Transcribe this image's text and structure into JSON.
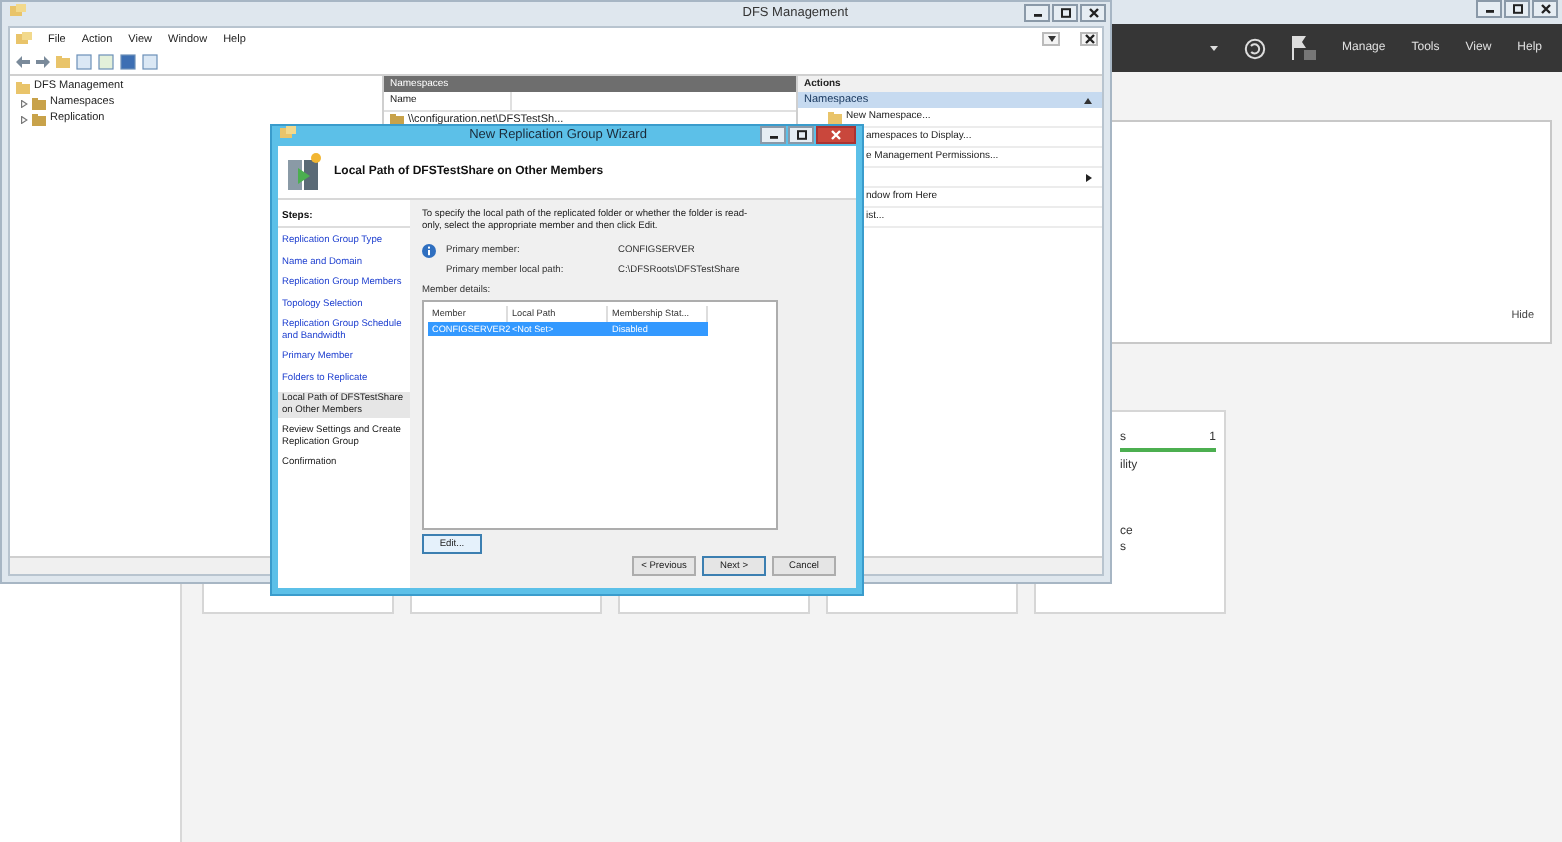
{
  "server_manager": {
    "menu": [
      "Manage",
      "Tools",
      "View",
      "Help"
    ],
    "welcome": {
      "hide_link": "Hide"
    },
    "tiles": [
      {
        "kind": "empty"
      },
      {
        "kind": "empty"
      },
      {
        "kind": "empty"
      },
      {
        "kind": "empty"
      },
      {
        "kind": "partial",
        "title": "s",
        "count": "1",
        "lines": [
          "ility",
          "ce",
          "s"
        ]
      }
    ]
  },
  "dfs_window": {
    "title": "DFS Management",
    "menu": [
      "File",
      "Action",
      "View",
      "Window",
      "Help"
    ],
    "tree": [
      {
        "label": "DFS Management",
        "children": [
          {
            "label": "Namespaces",
            "expanded": false
          },
          {
            "label": "Replication",
            "expanded": false
          }
        ]
      }
    ],
    "center_pane": {
      "header": "Namespaces",
      "columns": [
        "Name"
      ],
      "rows": [
        "\\\\configuration.net\\DFSTestSh..."
      ]
    },
    "actions_pane": {
      "title": "Actions",
      "section": "Namespaces",
      "expanded": true,
      "items": [
        {
          "kind": "command",
          "label": "New Namespace..."
        },
        {
          "kind": "clipped",
          "label": "amespaces to Display..."
        },
        {
          "kind": "clipped",
          "label": "e Management Permissions..."
        },
        {
          "kind": "submenu"
        },
        {
          "kind": "clipped",
          "label": "ndow from Here"
        },
        {
          "kind": "clipped",
          "label": "ist..."
        }
      ]
    }
  },
  "wizard": {
    "title": "New Replication Group Wizard",
    "heading": "Local Path of DFSTestShare on Other Members",
    "steps_title": "Steps:",
    "steps": [
      {
        "label": "Replication Group Type",
        "visited": true,
        "selected": false
      },
      {
        "label": "Name and Domain",
        "visited": true,
        "selected": false
      },
      {
        "label": "Replication Group Members",
        "visited": true,
        "selected": false
      },
      {
        "label": "Topology Selection",
        "visited": true,
        "selected": false
      },
      {
        "label": "Replication Group Schedule and Bandwidth",
        "visited": true,
        "selected": false
      },
      {
        "label": "Primary Member",
        "visited": true,
        "selected": false
      },
      {
        "label": "Folders to Replicate",
        "visited": true,
        "selected": false
      },
      {
        "label": "Local Path of DFSTestShare on Other Members",
        "visited": false,
        "selected": true
      },
      {
        "label": "Review Settings and Create Replication Group",
        "visited": false,
        "selected": false
      },
      {
        "label": "Confirmation",
        "visited": false,
        "selected": false
      }
    ],
    "description": "To specify the local path of the replicated folder or whether the folder is read-only, select the appropriate member and then click Edit.",
    "info": [
      {
        "label": "Primary member:",
        "value": "CONFIGSERVER"
      },
      {
        "label": "Primary member local path:",
        "value": "C:\\DFSRoots\\DFSTestShare"
      }
    ],
    "details_label": "Member details:",
    "members": {
      "columns": [
        "Member",
        "Local Path",
        "Membership Stat..."
      ],
      "rows": [
        {
          "cells": [
            "CONFIGSERVER2",
            "<Not Set>",
            "Disabled"
          ],
          "selected": true
        }
      ]
    },
    "edit_button": "Edit...",
    "buttons": [
      {
        "label": "< Previous",
        "default": false
      },
      {
        "label": "Next >",
        "default": true
      },
      {
        "label": "Cancel",
        "default": false
      }
    ]
  }
}
